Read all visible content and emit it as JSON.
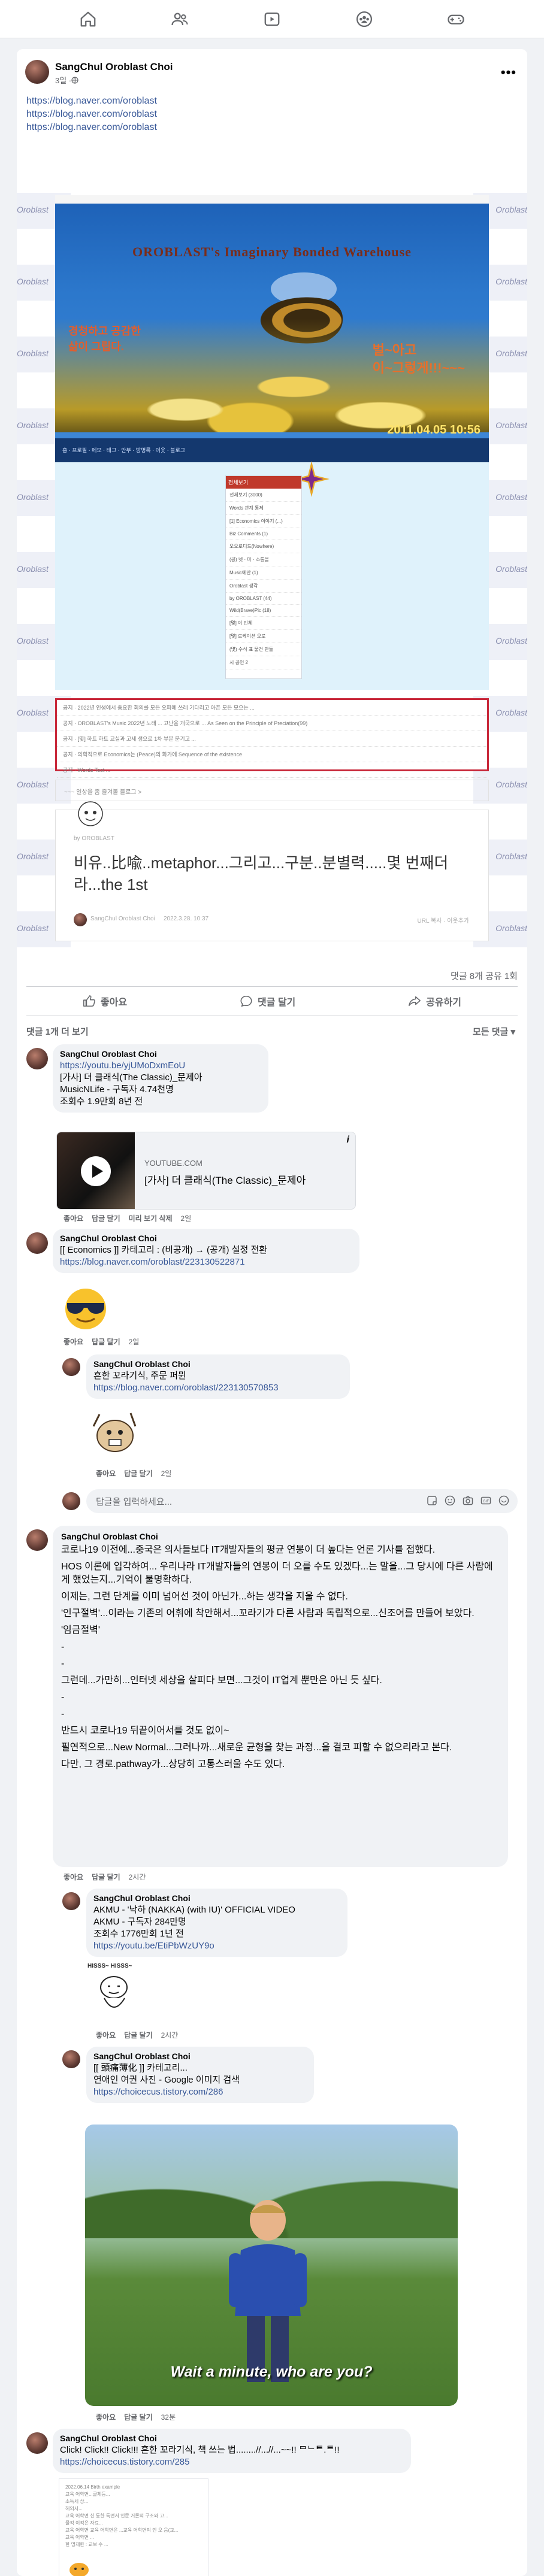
{
  "nav": {
    "items": [
      "home-icon",
      "friends-icon",
      "watch-icon",
      "groups-icon",
      "gaming-icon"
    ]
  },
  "post": {
    "author": "SangChul Oroblast Choi",
    "time": "3일 · ",
    "links": [
      "https://blog.naver.com/oroblast",
      "https://blog.naver.com/oroblast",
      "https://blog.naver.com/oroblast"
    ],
    "deco_word": "Oroblast",
    "banner": {
      "title": "OROBLAST's Imaginary Bonded Warehouse",
      "left_text": [
        "경청하고 공감한",
        "삶이 그립다."
      ],
      "right_text": [
        "벌~아고",
        "이~그렇게!!!~~~"
      ],
      "date": "2011.04.05 10:56",
      "bar_links": "홈 · 프로필 · 메모 · 태그 · 안부 · 방명록 · 이웃 · 블로그"
    },
    "menu": {
      "head": "전체보기",
      "items": [
        "전체보기 (3000)",
        "Words 관계 통제",
        "[1] Economics 이야기 (...)",
        "Biz Comments (1)",
        "오오로디드(Nowhere)",
        "(공) 넷 · 마 · 소통을",
        "Music에만 (1)",
        "Oroblast 생각",
        "by OROBLAST (44)",
        "Wild(Brave)Pic (18)",
        "[몇] 이 인체",
        "[몇] 로케이션 오로",
        "(몇) 수식 표 물건 만들",
        "시 공인 2"
      ]
    },
    "recent": [
      "공지 · 2022년 인생에서 중요한 회의를 모든 오피에 쓰레 기다리고 아픈 모든 모으는 ...",
      "공지 · OROBLAST's Music 2022년 노래 ... 고난을 개국으로 ... As Seen on the Principle of Preciation(99)",
      "공지 · [몇] 하트 하트 교실과 고세 생으로 1차 부분 문기고 ...",
      "공지 · 의학적으로 Economics는 (Peace)의 화가에 Sequence of the existence",
      "공지 · Words Test ..."
    ],
    "more_blog": "~~~ 일상을 좀 즐겨볼 블로그 >",
    "naver_card": {
      "by": "by OROBLAST",
      "title": "비유..比喩..metaphor...그리고...구분..분별력.....몇 번째더라...the 1st",
      "foot_author": "SangChul Oroblast Choi",
      "foot_date": "2022.3.28. 10:37",
      "foot_right": "URL 복사 · 이웃추가"
    },
    "counts": "댓글 8개   공유 1회",
    "actions": {
      "like": "좋아요",
      "comment": "댓글 달기",
      "share": "공유하기"
    }
  },
  "comments": {
    "more": "댓글 1개 더 보기",
    "filter": "모든 댓글 ▾",
    "c1": {
      "author": "SangChul Oroblast Choi",
      "lines": [
        "[가사] 더 클래식(The Classic)_문제아",
        "MusicNLife - 구독자 4.74천명",
        "조회수 1.9만회 8년 전"
      ],
      "link": "https://youtu.be/yjUMoDxmEoU",
      "preview_src": "YOUTUBE.COM",
      "preview_title": "[가사] 더 클래식(The Classic)_문제아",
      "acts": [
        "좋아요",
        "답글 달기",
        "미리 보기 삭제"
      ],
      "time": "2일"
    },
    "c2": {
      "author": "SangChul Oroblast Choi",
      "text": "[[ Economics ]] 카테고리 : (비공개) → (공개) 설정 전환",
      "link": "https://blog.naver.com/oroblast/223130522871",
      "acts": [
        "좋아요",
        "답글 달기"
      ],
      "time": "2일"
    },
    "r1": {
      "author": "SangChul Oroblast Choi",
      "text": "흔한 꼬라기식, 주문 퍼뮌",
      "link": "https://blog.naver.com/oroblast/223130570853",
      "acts": [
        "좋아요",
        "답글 달기"
      ],
      "time": "2일"
    },
    "reply_placeholder": "답글을 입력하세요...",
    "c3": {
      "author": "SangChul Oroblast Choi",
      "paras": [
        "코로나19 이전에...중국은 의사들보다 IT개발자들의 평균 연봉이 더 높다는 언론 기사를 접했다.",
        "HOS 이론에 입각하여... 우리나라 IT개발자들의 연봉이 더 오를 수도 있겠다...는 말을...그 당시에 다른 사람에게 했었는지...기억이 불명확하다.",
        "이제는, 그런 단계를 이미 넘어선 것이 아닌가...하는 생각을 지울 수 없다.",
        "'인구절벽'...이라는 기존의 어휘에 착안해서...꼬라기가 다른 사람과 독립적으로...신조어를 만들어 보았다.",
        "'임금절벽'",
        "-",
        "-",
        "그런데...가만히...인터넷 세상을 살피다 보면...그것이 IT업계 뿐만은 아닌 듯 싶다.",
        "-",
        "-",
        "반드시 코로나19 뒤끝이어서를 것도 없이~",
        "필연적으로...New Normal...그러나까...새로운 균형을 찾는 과정...을 결코 피할 수 없으리라고 본다.",
        "다만, 그 경로.pathway가...상당히 고통스러울 수도 있다."
      ],
      "acts": [
        "좋아요",
        "답글 달기"
      ],
      "time": "2시간"
    },
    "r2": {
      "author": "SangChul Oroblast Choi",
      "lines": [
        "AKMU - '낙하 (NAKKA) (with IU)' OFFICIAL VIDEO",
        "AKMU - 구독자 284만명",
        "조회수 1776만회 1년 전"
      ],
      "link": "https://youtu.be/EtiPbWzUY9o",
      "sticker_text": "HISSS~ HISSS~",
      "acts": [
        "좋아요",
        "답글 달기"
      ],
      "time": "2시간"
    },
    "r3": {
      "author": "SangChul Oroblast Choi",
      "lines": [
        "[[ 頭痛薄化 ]] 카테고리...",
        "연애인 여권 사진 - Google 이미지 검색"
      ],
      "link": "https://choicecus.tistory.com/286",
      "photo_caption": "Wait a minute, who are you?",
      "acts": [
        "좋아요",
        "답글 달기"
      ],
      "time": "32분"
    },
    "r4": {
      "author": "SangChul Oroblast Choi",
      "text": "Click! Click!! Click!!! 흔한 꼬라기식, 책 쓰는 법........//...//...~~!! ᄆᄂᄐ.ᄐ!!",
      "link": "https://choicecus.tistory.com/285",
      "doc_lines": [
        "2022.06.14  Birth example",
        "교육 어학면...글체등...",
        "소득세 상...",
        "해외사...",
        "교육 어학면 신 통한 특면서 인문 거론의 구조와 고...",
        "물적 이적은 자료...",
        "교육 어학면 교육 어학면은 ...교육 어학면의 인 오 음(교...",
        "교육 어학면 ...",
        "한 명재한 : 교보 수 ..."
      ]
    }
  },
  "colors": {
    "link": "#385898",
    "muted": "#65676b",
    "bg": "#f0f2f5",
    "accent_red": "#c8283a"
  }
}
